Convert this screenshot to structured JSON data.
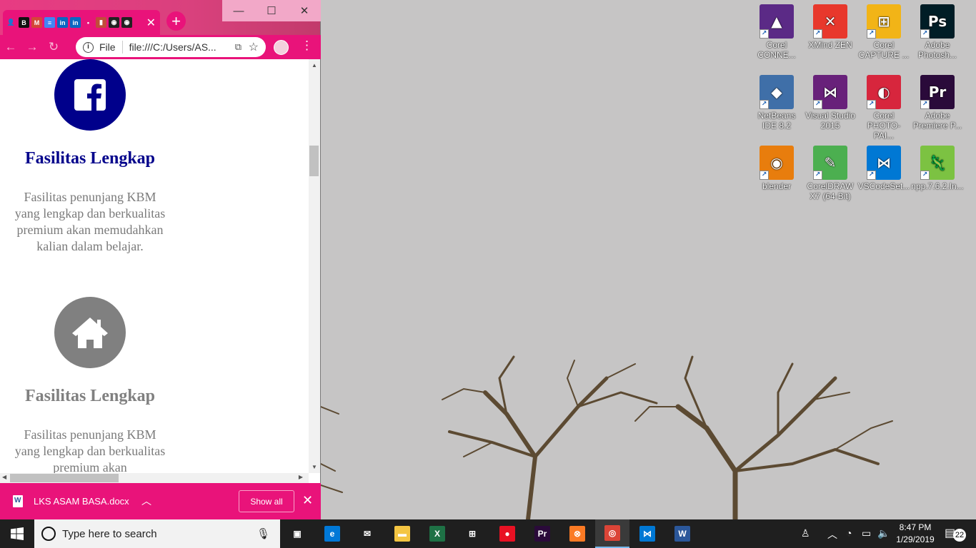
{
  "browser": {
    "tab_icons": [
      {
        "name": "contact-tab-icon",
        "glyph": "👤",
        "color": "#e9137a"
      },
      {
        "name": "blogger-tab-icon",
        "glyph": "B",
        "color": "#111111"
      },
      {
        "name": "gmail-tab-icon",
        "glyph": "M",
        "color": "#d44638"
      },
      {
        "name": "docs-tab-icon",
        "glyph": "≡",
        "color": "#4285f4"
      },
      {
        "name": "linkedin-tab-icon",
        "glyph": "in",
        "color": "#0a66c2"
      },
      {
        "name": "linkedin-tab-icon-2",
        "glyph": "in",
        "color": "#0a66c2"
      },
      {
        "name": "pink-tab-icon",
        "glyph": "•",
        "color": "#e9137a"
      },
      {
        "name": "office-tab-icon",
        "glyph": "▮",
        "color": "#c24b3a"
      },
      {
        "name": "github-tab-icon",
        "glyph": "◉",
        "color": "#222222"
      },
      {
        "name": "github-tab-icon-2",
        "glyph": "◉",
        "color": "#222222"
      }
    ],
    "tab_close": "✕",
    "new_tab": "+",
    "window": {
      "minimize": "—",
      "maximize": "☐",
      "close": "✕"
    },
    "nav": {
      "back": "←",
      "forward": "→",
      "reload": "↻"
    },
    "omnibox": {
      "scheme_label": "File",
      "url": "file:///C:/Users/AS..."
    },
    "menu": "⋮",
    "accent": "#e9137a"
  },
  "page": {
    "features": [
      {
        "title": "Fasilitas Lengkap",
        "text": "Fasilitas penunjang KBM yang lengkap dan berkualitas premium akan memudahkan kalian dalam belajar.",
        "icon": "facebook-icon",
        "circle_color": "#00008b",
        "title_color": "#00008b"
      },
      {
        "title": "Fasilitas Lengkap",
        "text": "Fasilitas penunjang KBM yang lengkap dan berkualitas premium akan",
        "icon": "home-icon",
        "circle_color": "#808080",
        "title_color": "#808080"
      }
    ]
  },
  "downloads": {
    "file_name": "LKS ASAM BASA.docx",
    "show_all": "Show all",
    "close": "✕"
  },
  "desktop_icons": [
    {
      "name": "corel-connect",
      "label": "Corel CONNE...",
      "glyph": "▲",
      "bg": "#5b2a86"
    },
    {
      "name": "xmind-zen",
      "label": "XMind ZEN",
      "glyph": "✕",
      "bg": "#e8382c"
    },
    {
      "name": "corel-capture",
      "label": "Corel CAPTURE ...",
      "glyph": "⊞",
      "bg": "#f2b417"
    },
    {
      "name": "adobe-photoshop",
      "label": "Adobe Photosh...",
      "glyph": "Ps",
      "bg": "#001d26"
    },
    {
      "name": "netbeans",
      "label": "NetBeans IDE 8.2",
      "glyph": "◆",
      "bg": "#3f6fa8"
    },
    {
      "name": "visual-studio-2015",
      "label": "Visual Studio 2015",
      "glyph": "⋈",
      "bg": "#68217a"
    },
    {
      "name": "corel-photo-paint",
      "label": "Corel PHOTO-PAI...",
      "glyph": "◐",
      "bg": "#d7263d"
    },
    {
      "name": "adobe-premiere",
      "label": "Adobe Premiere P...",
      "glyph": "Pr",
      "bg": "#2a0a3a"
    },
    {
      "name": "blender",
      "label": "blender",
      "glyph": "◉",
      "bg": "#e87d0d"
    },
    {
      "name": "coreldraw",
      "label": "CorelDRAW X7 (64-Bit)",
      "glyph": "✎",
      "bg": "#4caf50"
    },
    {
      "name": "vscode-setup",
      "label": "VSCodeSet...",
      "glyph": "⋈",
      "bg": "#0078d4"
    },
    {
      "name": "npp-installer",
      "label": "npp.7.6.2.In...",
      "glyph": "🦎",
      "bg": "#7cc242"
    }
  ],
  "taskbar": {
    "search_placeholder": "Type here to search",
    "time": "8:47 PM",
    "date": "1/29/2019",
    "notification_count": "22",
    "apps": [
      {
        "name": "task-view",
        "glyph": "▣",
        "bg": "transparent"
      },
      {
        "name": "edge",
        "glyph": "e",
        "bg": "#0078d7"
      },
      {
        "name": "mail",
        "glyph": "✉",
        "bg": "transparent"
      },
      {
        "name": "file-explorer",
        "glyph": "▬",
        "bg": "#f4c542"
      },
      {
        "name": "excel",
        "glyph": "X",
        "bg": "#1e7145"
      },
      {
        "name": "store",
        "glyph": "⊞",
        "bg": "transparent"
      },
      {
        "name": "recorder",
        "glyph": "●",
        "bg": "#e81123"
      },
      {
        "name": "premiere",
        "glyph": "Pr",
        "bg": "#2a0a3a"
      },
      {
        "name": "xampp",
        "glyph": "⊗",
        "bg": "#fb7a24"
      },
      {
        "name": "chrome",
        "glyph": "◎",
        "bg": "#db4437"
      },
      {
        "name": "vs-code",
        "glyph": "⋈",
        "bg": "#0078d4"
      },
      {
        "name": "word",
        "glyph": "W",
        "bg": "#2b579a"
      }
    ]
  }
}
